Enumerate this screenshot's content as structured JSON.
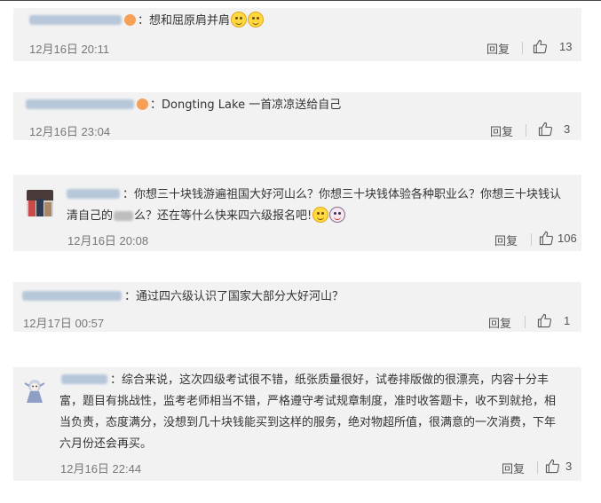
{
  "comments": [
    {
      "content": "想和屈原肩并肩",
      "time": "12月16日 20:11",
      "reply_label": "回复",
      "likes": "13",
      "emojis": [
        "smile-emoji",
        "smile-emoji"
      ]
    },
    {
      "content": "Dongting Lake 一首凉凉送给自己",
      "time": "12月16日 23:04",
      "reply_label": "回复",
      "likes": "3"
    },
    {
      "content_line1": "你想三十块钱游遍祖国大好河山么？你想三十块钱体验各种职业么？你想三十块钱认",
      "content_line2a": "清自己的",
      "content_line2b": "么？还在等什么快来四六级报名吧!",
      "time": "12月16日 20:08",
      "reply_label": "回复",
      "likes": "106",
      "emojis": [
        "smile-emoji",
        "doll-emoji"
      ]
    },
    {
      "content": "通过四六级认识了国家大部分大好河山？",
      "time": "12月17日 00:57",
      "reply_label": "回复",
      "likes": "1"
    },
    {
      "content_line1": "综合来说，这次四级考试很不错，纸张质量很好，试卷排版做的很漂亮，内容十分丰",
      "content_line2": "富，题目有挑战性，监考老师相当不错，严格遵守考试规章制度，准时收答题卡，收不到就抢，相",
      "content_line3": "当负责，态度满分，没想到几十块钱能买到这样的服务，绝对物超所值，很满意的一次消费，下年",
      "content_line4": "六月份还会再买。",
      "time": "12月16日 22:44",
      "reply_label": "回复",
      "likes": "3"
    }
  ],
  "colors": {
    "card_bg": "#f2f2f2",
    "username_blue": "#b7c7da",
    "text": "#333333",
    "meta": "#777777"
  }
}
